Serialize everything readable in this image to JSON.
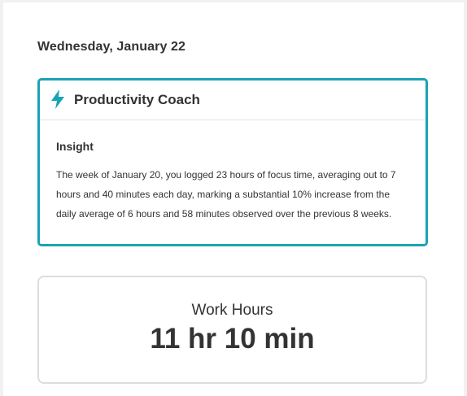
{
  "date": "Wednesday, January 22",
  "coach": {
    "title": "Productivity Coach",
    "icon": "lightning-bolt-icon",
    "accent_color": "#1aa3b3",
    "insight_label": "Insight",
    "insight_text": "The week of January 20, you logged 23 hours of focus time, averaging out to 7 hours and 40 minutes each day, marking a substantial 10% increase from the daily average of 6 hours and 58 minutes observed over the previous 8 weeks."
  },
  "work_hours": {
    "label": "Work Hours",
    "value": "11 hr 10 min"
  }
}
